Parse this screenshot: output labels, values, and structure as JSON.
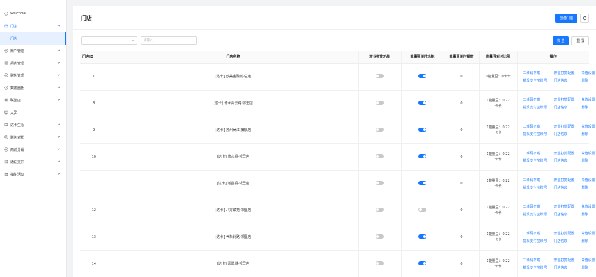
{
  "sidebar": {
    "items": [
      {
        "label": "Welcome",
        "icon": "smile-icon",
        "chevron": false
      },
      {
        "label": "门店",
        "icon": "shop-icon",
        "chevron": true,
        "open": true
      },
      {
        "label": "门店",
        "sub": true
      },
      {
        "label": "账户管理",
        "icon": "user-icon",
        "chevron": true
      },
      {
        "label": "报表管理",
        "icon": "report-icon",
        "chevron": true
      },
      {
        "label": "财务管理",
        "icon": "money-icon",
        "chevron": true
      },
      {
        "label": "数据面板",
        "icon": "dashboard-icon",
        "chevron": true
      },
      {
        "label": "联盟店",
        "icon": "store-icon",
        "chevron": true
      },
      {
        "label": "大屏",
        "icon": "monitor-icon",
        "chevron": false
      },
      {
        "label": "达卡生活",
        "icon": "wallet-icon",
        "chevron": true
      },
      {
        "label": "财务对账",
        "icon": "reconcile-icon",
        "chevron": true
      },
      {
        "label": "商城分销",
        "icon": "distribution-icon",
        "chevron": true
      },
      {
        "label": "通联支付",
        "icon": "pay-icon",
        "chevron": true
      },
      {
        "label": "抽奖活动",
        "icon": "gift-icon",
        "chevron": true
      }
    ]
  },
  "header": {
    "title": "门店",
    "create_label": "创建门店",
    "refresh_icon": "refresh-icon"
  },
  "filters": {
    "select_value": "",
    "input_placeholder": "请输入",
    "search_label": "筛 选",
    "reset_label": "重 置"
  },
  "table": {
    "columns": [
      "门店ID",
      "门店名称",
      "开业打赏功能",
      "能量豆兑付功能",
      "能量豆兑付额度",
      "能量豆对付比例",
      "操作"
    ],
    "op_labels": [
      "二维码下载",
      "开业打赏配置",
      "充值设置",
      "提现支付宝账号",
      "门店信息",
      "删除"
    ],
    "rows": [
      {
        "id": "1",
        "name": "[达卡] 欧美金融城·总店",
        "open_reward": false,
        "redeem": true,
        "quota": "0",
        "ratio_l1": "1能量豆：0卡卡",
        "ratio_l2": ""
      },
      {
        "id": "8",
        "name": "[达卡] 修水青云路·邻里店",
        "open_reward": false,
        "redeem": true,
        "quota": "0",
        "ratio_l1": "1能量豆：0.22",
        "ratio_l2": "卡卡"
      },
      {
        "id": "9",
        "name": "[达卡] 苏州吴江·旗舰店",
        "open_reward": false,
        "redeem": true,
        "quota": "0",
        "ratio_l1": "1能量豆：0.22",
        "ratio_l2": "卡卡"
      },
      {
        "id": "10",
        "name": "[达卡] 修水县·邻里店",
        "open_reward": false,
        "redeem": true,
        "quota": "0",
        "ratio_l1": "1能量豆：0.22",
        "ratio_l2": "卡卡"
      },
      {
        "id": "11",
        "name": "[达卡] 遂昌县·邻里店",
        "open_reward": false,
        "redeem": true,
        "quota": "0",
        "ratio_l1": "1能量豆：0.22",
        "ratio_l2": "卡卡"
      },
      {
        "id": "12",
        "name": "[达卡] 八方镇苑·邻里店",
        "open_reward": false,
        "redeem": false,
        "quota": "0",
        "ratio_l1": "1能量豆：0.22",
        "ratio_l2": "卡卡"
      },
      {
        "id": "13",
        "name": "[达卡] 气象北路·邻里店",
        "open_reward": false,
        "redeem": true,
        "quota": "0",
        "ratio_l1": "1能量豆：0.22",
        "ratio_l2": "卡卡"
      },
      {
        "id": "14",
        "name": "[达卡] 嘉翠城·邻里店",
        "open_reward": false,
        "redeem": true,
        "quota": "0",
        "ratio_l1": "1能量豆：0.22",
        "ratio_l2": "卡卡"
      }
    ]
  },
  "colors": {
    "accent": "#1677ff",
    "switch_off": "#c8c8c8",
    "sidebar_active_bg": "#e6f0ff"
  }
}
